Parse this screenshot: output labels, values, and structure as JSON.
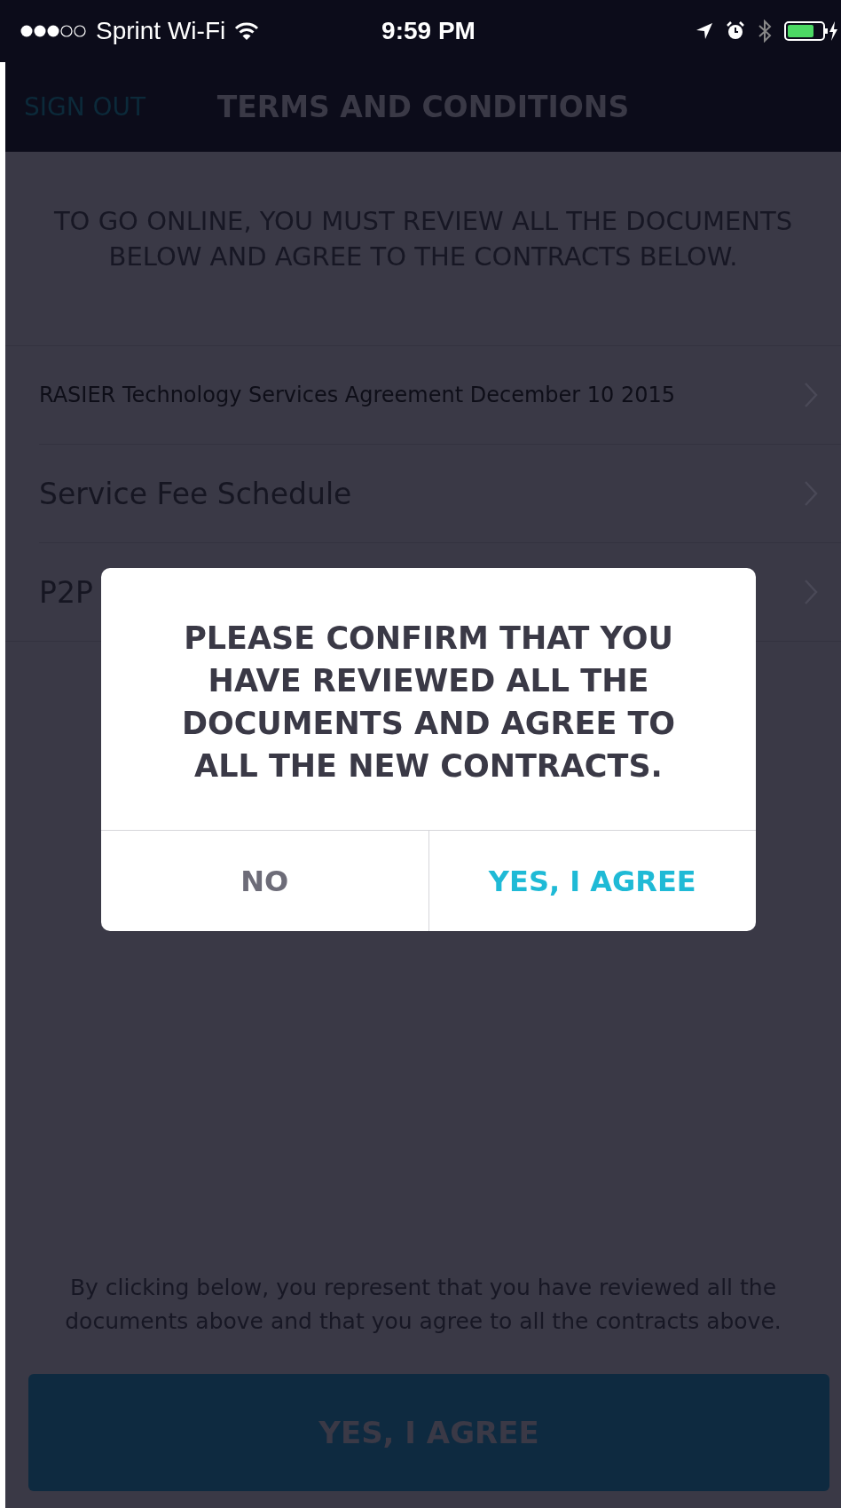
{
  "status_bar": {
    "carrier": "Sprint Wi-Fi",
    "time": "9:59 PM"
  },
  "nav": {
    "sign_out": "SIGN OUT",
    "title": "TERMS AND CONDITIONS"
  },
  "intro": "TO GO ONLINE, YOU MUST REVIEW ALL THE DOCUMENTS BELOW AND AGREE TO THE CONTRACTS BELOW.",
  "documents": [
    {
      "title": "RASIER Technology Services Agreement December 10 2015"
    },
    {
      "title": "Service Fee Schedule"
    },
    {
      "title": "P2P"
    }
  ],
  "footer_note": "By clicking below, you represent that you have reviewed all the documents above and that you agree to all the contracts above.",
  "agree_button": "YES, I AGREE",
  "dialog": {
    "message": "PLEASE CONFIRM THAT YOU HAVE REVIEWED ALL THE DOCUMENTS AND AGREE TO ALL THE NEW CONTRACTS.",
    "buttons": [
      {
        "label": "NO",
        "kind": "cancel"
      },
      {
        "label": "YES, I AGREE",
        "kind": "confirm"
      }
    ]
  }
}
